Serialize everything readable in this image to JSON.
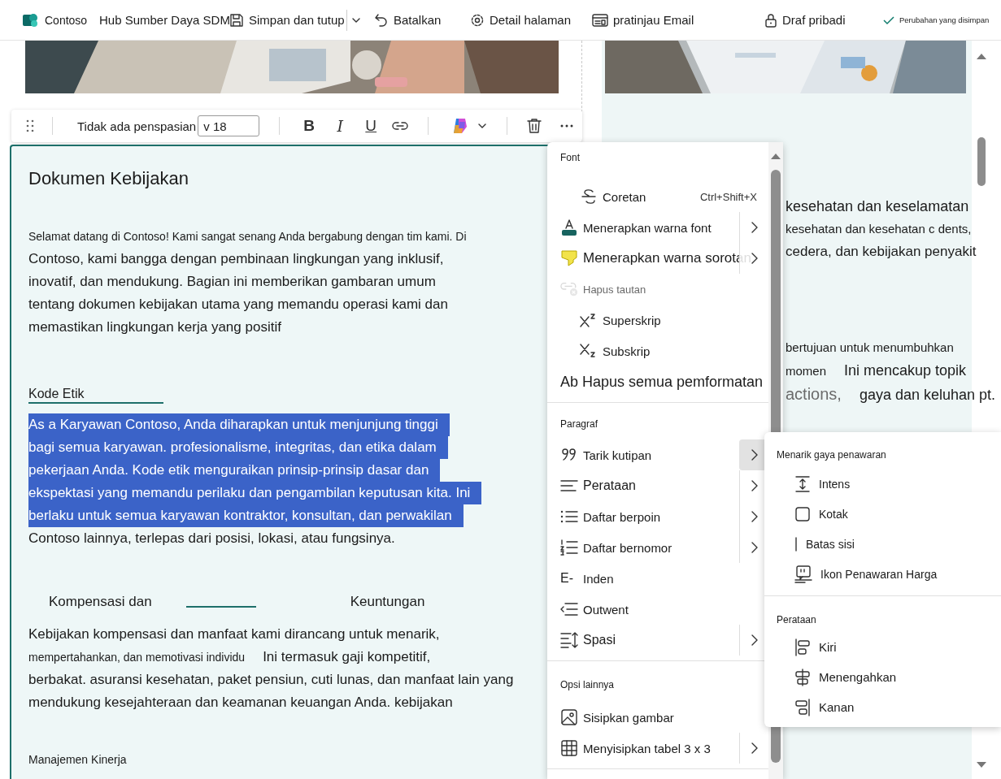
{
  "top_bar": {
    "site_name": "Contoso",
    "page_title": "Hub Sumber Daya SDM",
    "actions": [
      {
        "label": "Simpan dan tutup",
        "has_dropdown": true
      },
      {
        "label": "Batalkan"
      },
      {
        "label": "Detail halaman"
      },
      {
        "label": "pratinjau Email"
      },
      {
        "label": "Draf pribadi"
      }
    ],
    "save_status": "Perubahan yang disimpan"
  },
  "format_toolbar": {
    "style": "Tidak ada penspasian",
    "font_size": "v 18",
    "text_styles": [
      "B",
      "I",
      "U"
    ]
  },
  "document": {
    "title": "Dokumen Kebijakan",
    "blocks": [
      {
        "kind": "paragraph",
        "lines": [
          {
            "segments": [
              "Selamat datang di Contoso!  Kami sangat senang Anda bergabung dengan tim kami. Di"
            ],
            "selected": false
          },
          {
            "segments": [
              "Contoso, kami bangga dengan pembinaan lingkungan yang inklusif,"
            ],
            "selected": false
          },
          {
            "segments": [
              "inovatif, dan mendukung. Bagian ini memberikan gambaran umum"
            ],
            "selected": false
          },
          {
            "segments": [
              "tentang dokumen kebijakan utama yang memandu operasi kami dan"
            ],
            "selected": false
          },
          {
            "segments": [
              "memastikan lingkungan kerja yang positif"
            ],
            "selected": false
          }
        ]
      },
      {
        "kind": "heading",
        "text": "Kode Etik"
      },
      {
        "kind": "paragraph",
        "lines": [
          {
            "segments": [
              "As a Karyawan Contoso, Anda diharapkan untuk menjunjung tinggi"
            ],
            "selected": true
          },
          {
            "segments": [
              "bagi semua karyawan. profesionalisme, integritas, dan etika dalam"
            ],
            "selected": true
          },
          {
            "segments": [
              "pekerjaan Anda. Kode etik menguraikan prinsip-prinsip dasar dan"
            ],
            "selected": true
          },
          {
            "segments": [
              "ekspektasi yang memandu perilaku dan pengambilan keputusan kita. Ini"
            ],
            "selected": true
          },
          {
            "segments": [
              "berlaku untuk semua karyawan kontraktor, konsultan, dan perwakilan"
            ],
            "selected": true
          },
          {
            "segments": [
              "Contoso lainnya, terlepas dari posisi, lokasi, atau fungsinya."
            ],
            "selected": false
          }
        ]
      },
      {
        "kind": "split_heading",
        "parts": [
          "Kompensasi dan",
          "Keuntungan"
        ]
      },
      {
        "kind": "paragraph",
        "lines": [
          {
            "segments": [
              "Kebijakan kompensasi dan manfaat kami dirancang untuk menarik,"
            ],
            "selected": false
          },
          {
            "segments": [
              "mempertahankan, dan memotivasi individu",
              "Ini termasuk gaji kompetitif,"
            ],
            "selected": false
          },
          {
            "segments": [
              "berbakat. asuransi kesehatan, paket pensiun, cuti lunas, dan manfaat lain yang"
            ],
            "selected": false
          },
          {
            "segments": [
              "mendukung kesejahteraan dan keamanan keuangan Anda. kebijakan"
            ],
            "selected": false
          }
        ]
      },
      {
        "kind": "minor_heading",
        "text": "Manajemen Kinerja"
      }
    ]
  },
  "side_text": {
    "groups": [
      {
        "rows": [
          [
            "kesehatan dan keselamatan"
          ],
          [
            "kesehatan dan kesehatan c dents,"
          ],
          [
            "cedera, dan kebijakan penyakit"
          ]
        ]
      },
      {
        "rows": [
          [
            "bertujuan untuk menumbuhkan"
          ],
          [
            "momen",
            "Ini mencakup topik"
          ],
          [
            "actions,",
            "gaya dan keluhan pt."
          ]
        ]
      }
    ]
  },
  "context_menu": {
    "sections": [
      {
        "title": "Font",
        "items": [
          {
            "label": "Coretan",
            "shortcut": "Ctrl+Shift+X",
            "submenu": false,
            "disabled": false
          },
          {
            "label": "Menerapkan warna font",
            "submenu": true,
            "expanded": false,
            "disabled": false
          },
          {
            "label": "Menerapkan warna sorotan",
            "submenu": true,
            "expanded": false,
            "disabled": false
          },
          {
            "label": "Hapus tautan",
            "submenu": false,
            "disabled": true
          },
          {
            "label": "Superskrip",
            "submenu": false,
            "disabled": false
          },
          {
            "label": "Subskrip",
            "submenu": false,
            "disabled": false
          },
          {
            "label": "Ab Hapus semua pemformatan",
            "submenu": false,
            "disabled": false
          }
        ]
      },
      {
        "title": "Paragraf",
        "items": [
          {
            "label": "Tarik kutipan",
            "submenu": true,
            "expanded": true,
            "disabled": false
          },
          {
            "label": "Perataan",
            "submenu": true,
            "expanded": false,
            "disabled": false
          },
          {
            "label": "Daftar berpoin",
            "submenu": true,
            "expanded": false,
            "disabled": false
          },
          {
            "label": "Daftar bernomor",
            "submenu": true,
            "expanded": false,
            "disabled": false
          },
          {
            "label": "Inden",
            "glyph": "E-",
            "submenu": false,
            "disabled": false
          },
          {
            "label": "Outwent",
            "submenu": false,
            "disabled": false
          },
          {
            "label": "Spasi",
            "submenu": true,
            "expanded": false,
            "disabled": false
          }
        ]
      },
      {
        "title": "Opsi lainnya",
        "items": [
          {
            "label": "Sisipkan gambar",
            "submenu": false,
            "disabled": false
          },
          {
            "label": "Menyisipkan tabel 3 x 3",
            "submenu": true,
            "expanded": false,
            "disabled": false
          }
        ]
      }
    ]
  },
  "submenu": {
    "sections": [
      {
        "title": "Menarik gaya penawaran",
        "items": [
          {
            "label": "Intens"
          },
          {
            "label": "Kotak"
          },
          {
            "label": "Batas sisi"
          },
          {
            "label": "Ikon Penawaran Harga"
          }
        ]
      },
      {
        "title": "Perataan",
        "items": [
          {
            "label": "Kiri"
          },
          {
            "label": "Menengahkan"
          },
          {
            "label": "Kanan"
          }
        ]
      }
    ]
  }
}
